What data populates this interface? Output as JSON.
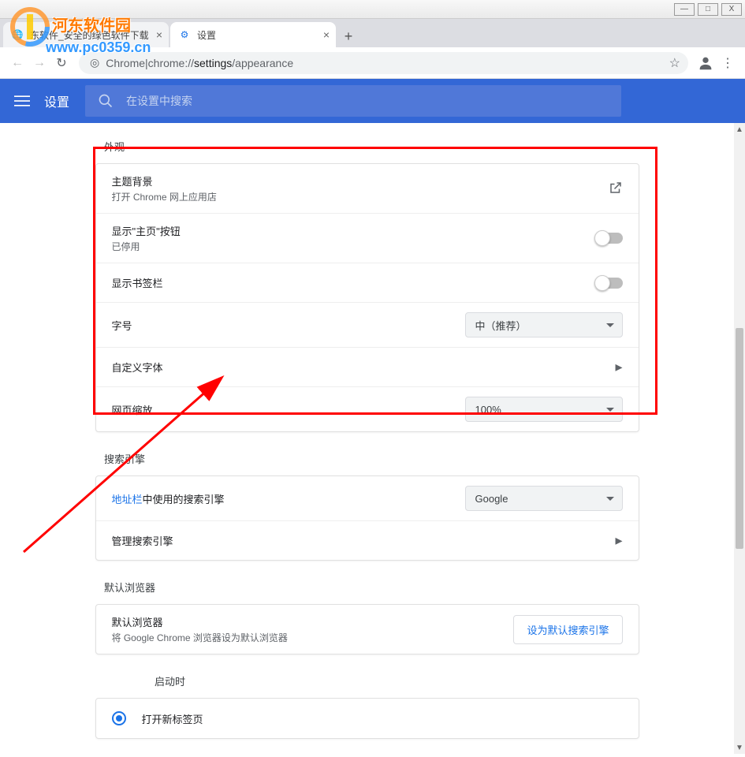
{
  "window": {
    "minimize": "—",
    "maximize": "□",
    "close": "X"
  },
  "tabs": {
    "t1": {
      "title": "东软件_安全的绿色软件下载",
      "close": "×"
    },
    "t2": {
      "title": "设置",
      "close": "×",
      "icon": "⚙"
    },
    "new": "+"
  },
  "addr": {
    "back": "←",
    "forward": "→",
    "reload": "↻",
    "scheme": "Chrome",
    "sep": " | ",
    "url_prefix": "chrome://",
    "url_bold": "settings",
    "url_rest": "/appearance",
    "star": "☆",
    "user": "●",
    "menu": "⋮"
  },
  "header": {
    "menu": "≡",
    "title": "设置",
    "search_placeholder": "在设置中搜索"
  },
  "appearance": {
    "title": "外观",
    "theme_label": "主题背景",
    "theme_sub": "打开 Chrome 网上应用店",
    "home_label": "显示\"主页\"按钮",
    "home_sub": "已停用",
    "bookmarks_label": "显示书签栏",
    "fontsize_label": "字号",
    "fontsize_value": "中（推荐）",
    "customfont_label": "自定义字体",
    "zoom_label": "网页缩放",
    "zoom_value": "100%"
  },
  "search": {
    "title": "搜索引擎",
    "engine_prefix": "地址栏",
    "engine_suffix": "中使用的搜索引擎",
    "engine_value": "Google",
    "manage_label": "管理搜索引擎"
  },
  "default_browser": {
    "title": "默认浏览器",
    "label": "默认浏览器",
    "sub": "将 Google Chrome 浏览器设为默认浏览器",
    "button": "设为默认搜索引擎"
  },
  "startup": {
    "title": "启动时",
    "opt1": "打开新标签页"
  },
  "watermark": {
    "text1": "河东软件园",
    "text2": "www.pc0359.cn"
  }
}
